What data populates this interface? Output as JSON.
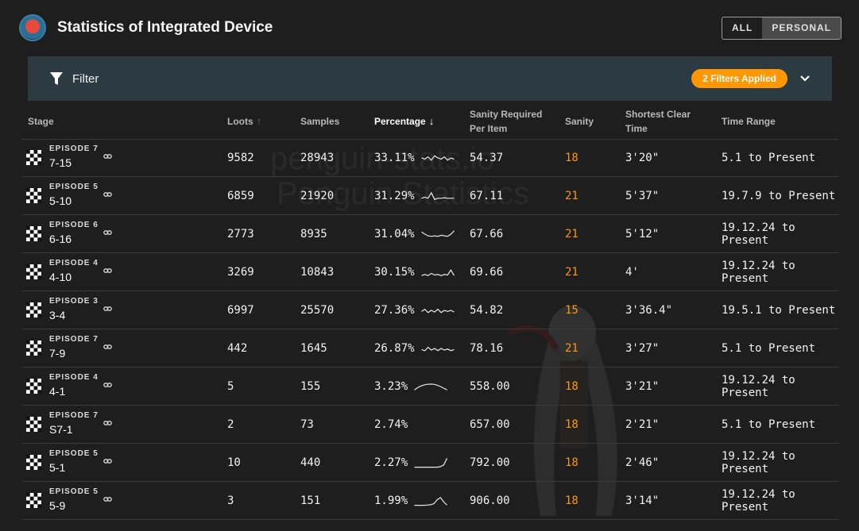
{
  "header": {
    "title": "Statistics of Integrated Device",
    "toggle": {
      "all_label": "ALL",
      "personal_label": "PERSONAL",
      "active": "PERSONAL"
    }
  },
  "filter": {
    "label": "Filter",
    "badge": "2 Filters Applied"
  },
  "watermark": {
    "line1": "penguin-stats.io",
    "line2": "Penguin Statistics"
  },
  "table": {
    "columns": {
      "stage": "Stage",
      "loots": "Loots",
      "samples": "Samples",
      "percentage": "Percentage",
      "sanity_per_item_1": "Sanity Required",
      "sanity_per_item_2": "Per Item",
      "sanity": "Sanity",
      "clear_time_1": "Shortest Clear",
      "clear_time_2": "Time",
      "time_range": "Time Range"
    },
    "rows": [
      {
        "zone": "EPISODE 7",
        "code": "7-15",
        "loots": "9582",
        "samples": "28943",
        "percentage": "33.11%",
        "per_item": "54.37",
        "sanity": "18",
        "time": "3'20\"",
        "range": "5.1 to Present",
        "spark": [
          0.5,
          0.4,
          0.6,
          0.3,
          0.7,
          0.5,
          0.4,
          0.6,
          0.3,
          0.5,
          0.4
        ]
      },
      {
        "zone": "EPISODE 5",
        "code": "5-10",
        "loots": "6859",
        "samples": "21920",
        "percentage": "31.29%",
        "per_item": "67.11",
        "sanity": "21",
        "time": "5'37\"",
        "range": "19.7.9 to Present",
        "spark": [
          0.3,
          0.4,
          0.3,
          0.8,
          0.2,
          0.3,
          0.3,
          0.35,
          0.3,
          0.3,
          0.3
        ]
      },
      {
        "zone": "EPISODE 6",
        "code": "6-16",
        "loots": "2773",
        "samples": "8935",
        "percentage": "31.04%",
        "per_item": "67.66",
        "sanity": "21",
        "time": "5'12\"",
        "range": "19.12.24 to Present",
        "spark": [
          0.7,
          0.5,
          0.35,
          0.3,
          0.35,
          0.3,
          0.4,
          0.35,
          0.3,
          0.5,
          0.8
        ]
      },
      {
        "zone": "EPISODE 4",
        "code": "4-10",
        "loots": "3269",
        "samples": "10843",
        "percentage": "30.15%",
        "per_item": "69.66",
        "sanity": "21",
        "time": "4'",
        "range": "19.12.24 to Present",
        "spark": [
          0.2,
          0.3,
          0.2,
          0.4,
          0.25,
          0.3,
          0.2,
          0.3,
          0.25,
          0.7,
          0.2
        ]
      },
      {
        "zone": "EPISODE 3",
        "code": "3-4",
        "loots": "6997",
        "samples": "25570",
        "percentage": "27.36%",
        "per_item": "54.82",
        "sanity": "15",
        "time": "3'36.4\"",
        "range": "19.5.1 to Present",
        "spark": [
          0.4,
          0.6,
          0.3,
          0.5,
          0.35,
          0.6,
          0.3,
          0.5,
          0.4,
          0.5,
          0.35
        ]
      },
      {
        "zone": "EPISODE 7",
        "code": "7-9",
        "loots": "442",
        "samples": "1645",
        "percentage": "26.87%",
        "per_item": "78.16",
        "sanity": "21",
        "time": "3'27\"",
        "range": "5.1 to Present",
        "spark": [
          0.4,
          0.3,
          0.6,
          0.35,
          0.5,
          0.3,
          0.5,
          0.35,
          0.45,
          0.3,
          0.4
        ]
      },
      {
        "zone": "EPISODE 4",
        "code": "4-1",
        "loots": "5",
        "samples": "155",
        "percentage": "3.23%",
        "per_item": "558.00",
        "sanity": "18",
        "time": "3'21\"",
        "range": "19.12.24 to Present",
        "spark": [
          0.2,
          0.4,
          0.55,
          0.65,
          0.7,
          0.72,
          0.7,
          0.62,
          0.5,
          0.35,
          0.2
        ]
      },
      {
        "zone": "EPISODE 7",
        "code": "S7-1",
        "loots": "2",
        "samples": "73",
        "percentage": "2.74%",
        "per_item": "657.00",
        "sanity": "18",
        "time": "2'21\"",
        "range": "5.1 to Present",
        "spark": []
      },
      {
        "zone": "EPISODE 5",
        "code": "5-1",
        "loots": "10",
        "samples": "440",
        "percentage": "2.27%",
        "per_item": "792.00",
        "sanity": "18",
        "time": "2'46\"",
        "range": "19.12.24 to Present",
        "spark": [
          0.1,
          0.1,
          0.1,
          0.1,
          0.1,
          0.1,
          0.1,
          0.1,
          0.15,
          0.3,
          0.9
        ]
      },
      {
        "zone": "EPISODE 5",
        "code": "5-9",
        "loots": "3",
        "samples": "151",
        "percentage": "1.99%",
        "per_item": "906.00",
        "sanity": "18",
        "time": "3'14\"",
        "range": "19.12.24 to Present",
        "spark": [
          0.1,
          0.1,
          0.1,
          0.1,
          0.12,
          0.15,
          0.25,
          0.6,
          0.8,
          0.4,
          0.12
        ]
      }
    ]
  },
  "colors": {
    "accent": "#ff9800",
    "background": "#1e1e1e",
    "filter_bar": "#2c3a42"
  }
}
